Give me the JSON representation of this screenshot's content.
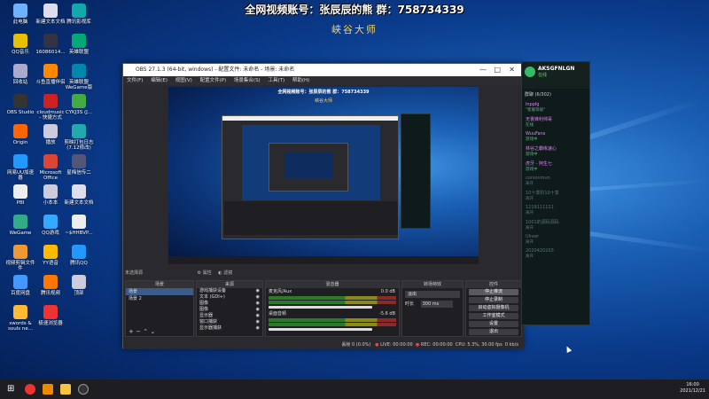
{
  "banner": {
    "line1": "全网视频账号：张辰辰的熊  群：758734339",
    "line2": "峡谷大师"
  },
  "desktop_icons": [
    {
      "label": "此电脑",
      "color": "#6fb3ff"
    },
    {
      "label": "新建文本文档",
      "color": "#dde"
    },
    {
      "label": "腾讯影视库",
      "color": "#1aa"
    },
    {
      "label": "QQ音乐",
      "color": "#e8c000"
    },
    {
      "label": "16086014...",
      "color": "#334"
    },
    {
      "label": "英雄联盟",
      "color": "#0a7"
    },
    {
      "label": "回收站",
      "color": "#aac"
    },
    {
      "label": "斗鱼直播伴侣",
      "color": "#f80"
    },
    {
      "label": "英雄联盟 WeGame版",
      "color": "#08a"
    },
    {
      "label": "OBS Studio",
      "color": "#333"
    },
    {
      "label": "cloudmusic - 快捷方式",
      "color": "#c22"
    },
    {
      "label": "CYKJ3S (J...",
      "color": "#4a4"
    },
    {
      "label": "Origin",
      "color": "#f60"
    },
    {
      "label": "播放",
      "color": "#ccd"
    },
    {
      "label": "剪映打包日志 (7.12修改)",
      "color": "#2aa"
    },
    {
      "label": "网易UU加速器",
      "color": "#29f"
    },
    {
      "label": "Microsoft Office",
      "color": "#d43"
    },
    {
      "label": "星梅信传二",
      "color": "#557"
    },
    {
      "label": "PBI",
      "color": "#eee"
    },
    {
      "label": "小本本",
      "color": "#ccd"
    },
    {
      "label": "新建文本文档",
      "color": "#dde"
    },
    {
      "label": "WeGame",
      "color": "#3a8"
    },
    {
      "label": "QQ游戏",
      "color": "#3af"
    },
    {
      "label": "~$HHBVP...",
      "color": "#eee"
    },
    {
      "label": "视频剪辑文件件",
      "color": "#e93"
    },
    {
      "label": "YY语音",
      "color": "#fb0"
    },
    {
      "label": "腾讯QQ",
      "color": "#29f"
    },
    {
      "label": "百度网盘",
      "color": "#49f"
    },
    {
      "label": "腾讯视频",
      "color": "#f70"
    },
    {
      "label": "顶部",
      "color": "#ccd"
    },
    {
      "label": "swords & souls ne...",
      "color": "#fb3"
    },
    {
      "label": "极速浏览器",
      "color": "#e33"
    }
  ],
  "obs": {
    "title": "OBS 27.1.3 (64-bit, windows) - 配置文件: 未命名 - 场景: 未命名",
    "menu": [
      "文件(F)",
      "编辑(E)",
      "视图(V)",
      "配置文件(P)",
      "场景集合(S)",
      "工具(T)",
      "帮助(H)"
    ],
    "no_source": "未选择源",
    "props_button": "属性",
    "filters_button": "滤镜",
    "scenes_header": "场景",
    "scenes": [
      "场景",
      "场景 2"
    ],
    "sources_header": "来源",
    "sources": [
      "游戏捕获设备",
      "文本 (GDI+)",
      "图像",
      "图像",
      "显示器",
      "窗口捕获",
      "显示器捕获"
    ],
    "mixer_header": "混音器",
    "mixer": [
      {
        "name": "麦克风/Aux",
        "db": "0.0 dB"
      },
      {
        "name": "桌面音频",
        "db": "-5.6 dB"
      }
    ],
    "transitions_header": "转场特效",
    "transition": "淡出",
    "duration_label": "时长",
    "duration": "300 ms",
    "controls_header": "控件",
    "controls": [
      "停止推流",
      "停止录制",
      "启动虚拟摄像机",
      "工作室模式",
      "设置",
      "退出"
    ],
    "status": {
      "dropped": "丢帧 0 (0.0%)",
      "live": "LIVE: 00:00:00",
      "rec": "REC: 00:00:00",
      "cpu": "CPU: 5.3%, 30.00 fps",
      "bitrate": "0 kb/s"
    }
  },
  "chat": {
    "name": "AKSGFNLGN",
    "status": "在线",
    "group_label": "群聊 (6/302)",
    "items": [
      {
        "title": "lnpplg",
        "sub": "\"客服等级\""
      },
      {
        "title": "无畏锋利帅哥",
        "sub": "在线"
      },
      {
        "title": "WuuFans",
        "sub": "游戏中"
      },
      {
        "title": "林谷之霸练速心",
        "sub": "游戏中"
      },
      {
        "title": "虎牙 - 阿生七",
        "sub": "游戏中"
      },
      {
        "title": "conionmun",
        "sub": "离开",
        "dim": true
      },
      {
        "title": "10十季阶10十季",
        "sub": "离开",
        "dim": true
      },
      {
        "title": "1219111121",
        "sub": "离开",
        "dim": true
      },
      {
        "title": "1001的源码源码",
        "sub": "离开",
        "dim": true
      },
      {
        "title": "Ulreer",
        "sub": "离开",
        "dim": true
      },
      {
        "title": "2020420203",
        "sub": "离开",
        "dim": true
      }
    ]
  },
  "taskbar": {
    "time": "16:00",
    "date": "2021/12/21"
  }
}
